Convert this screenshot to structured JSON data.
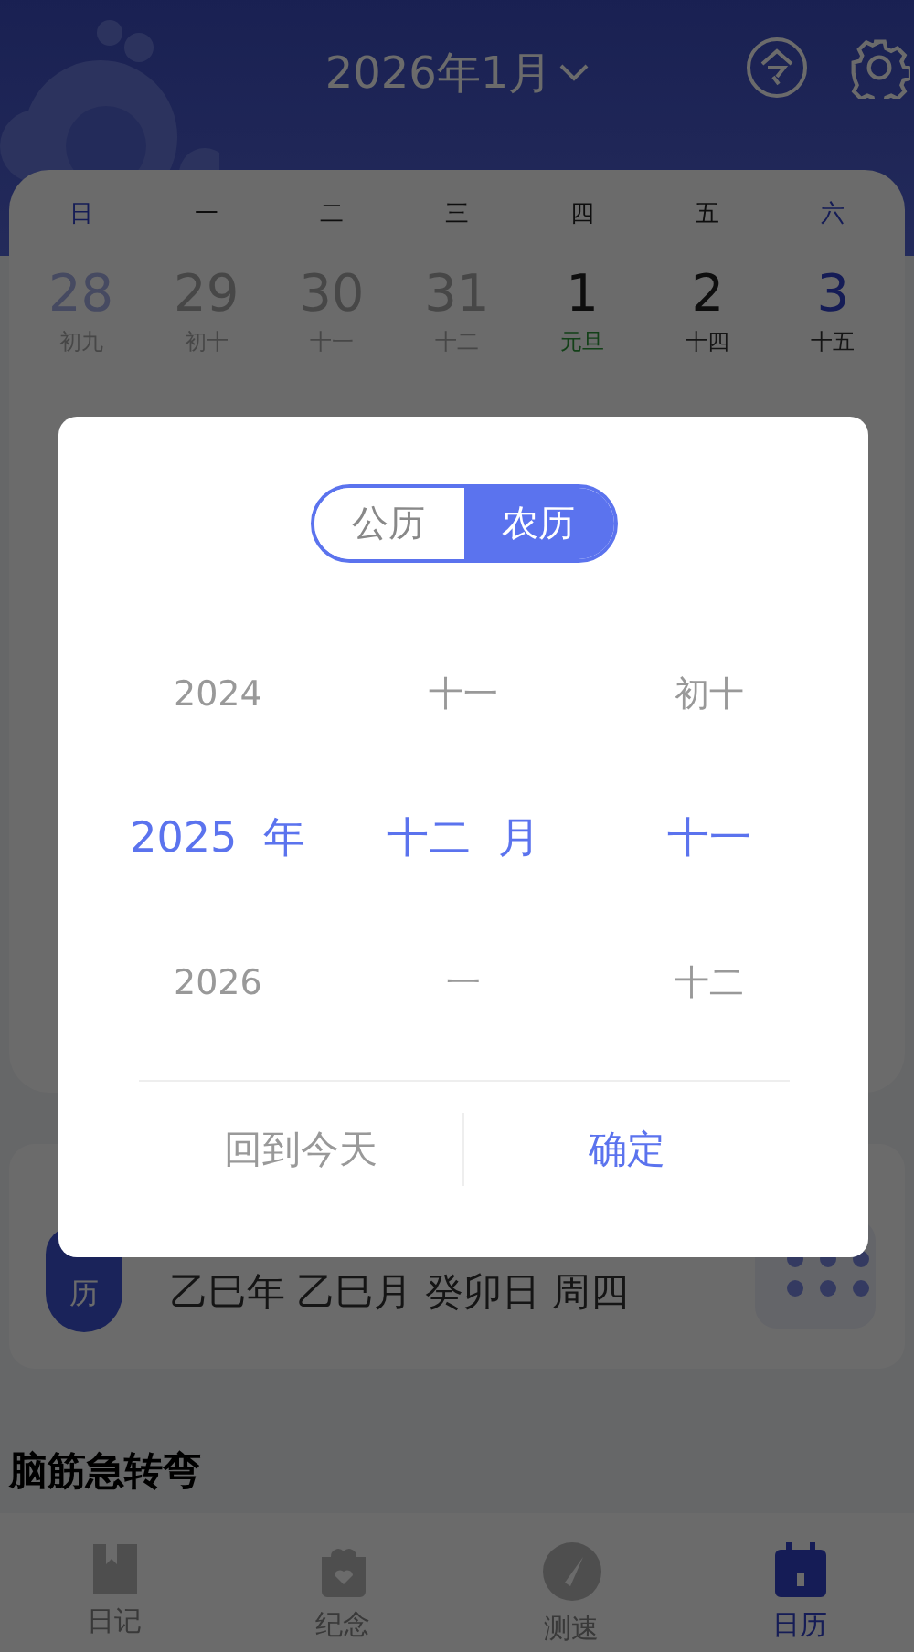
{
  "header": {
    "title": "2026年1月"
  },
  "weekdays": [
    {
      "label": "日",
      "weekend": true
    },
    {
      "label": "一",
      "weekend": false
    },
    {
      "label": "二",
      "weekend": false
    },
    {
      "label": "三",
      "weekend": false
    },
    {
      "label": "四",
      "weekend": false
    },
    {
      "label": "五",
      "weekend": false
    },
    {
      "label": "六",
      "weekend": true
    }
  ],
  "days": [
    {
      "day": "28",
      "lunar": "初九",
      "kind": "other_month",
      "weekend": true,
      "holiday": false
    },
    {
      "day": "29",
      "lunar": "初十",
      "kind": "other_month",
      "weekend": false,
      "holiday": false
    },
    {
      "day": "30",
      "lunar": "十一",
      "kind": "other_month",
      "weekend": false,
      "holiday": false
    },
    {
      "day": "31",
      "lunar": "十二",
      "kind": "other_month",
      "weekend": false,
      "holiday": false
    },
    {
      "day": "1",
      "lunar": "元旦",
      "kind": "current",
      "weekend": false,
      "holiday": true
    },
    {
      "day": "2",
      "lunar": "十四",
      "kind": "current",
      "weekend": false,
      "holiday": false
    },
    {
      "day": "3",
      "lunar": "十五",
      "kind": "current",
      "weekend": true,
      "holiday": false
    }
  ],
  "info_card": {
    "badge": "历",
    "text": "乙巳年 乙巳月 癸卯日 周四"
  },
  "section_title": "脑筋急转弯",
  "nav": [
    {
      "label": "日记",
      "kind": "diary",
      "selected": false
    },
    {
      "label": "纪念",
      "kind": "gift",
      "selected": false
    },
    {
      "label": "测速",
      "kind": "gauge",
      "selected": false
    },
    {
      "label": "日历",
      "kind": "calendar",
      "selected": true
    }
  ],
  "dialog": {
    "modes": [
      {
        "label": "公历",
        "selected": false
      },
      {
        "label": "农历",
        "selected": true
      }
    ],
    "wheels": [
      {
        "unit": "年",
        "items": [
          {
            "label": "2024",
            "selected": false
          },
          {
            "label": "2025",
            "selected": true
          },
          {
            "label": "2026",
            "selected": false
          }
        ]
      },
      {
        "unit": "月",
        "items": [
          {
            "label": "十一",
            "selected": false
          },
          {
            "label": "十二",
            "selected": true
          },
          {
            "label": "一",
            "selected": false
          }
        ]
      },
      {
        "items": [
          {
            "label": "初十",
            "selected": false
          },
          {
            "label": "十一",
            "selected": true
          },
          {
            "label": "十二",
            "selected": false
          }
        ]
      }
    ],
    "buttons": [
      {
        "label": "回到今天",
        "kind": "secondary"
      },
      {
        "label": "确定",
        "kind": "primary"
      }
    ]
  }
}
